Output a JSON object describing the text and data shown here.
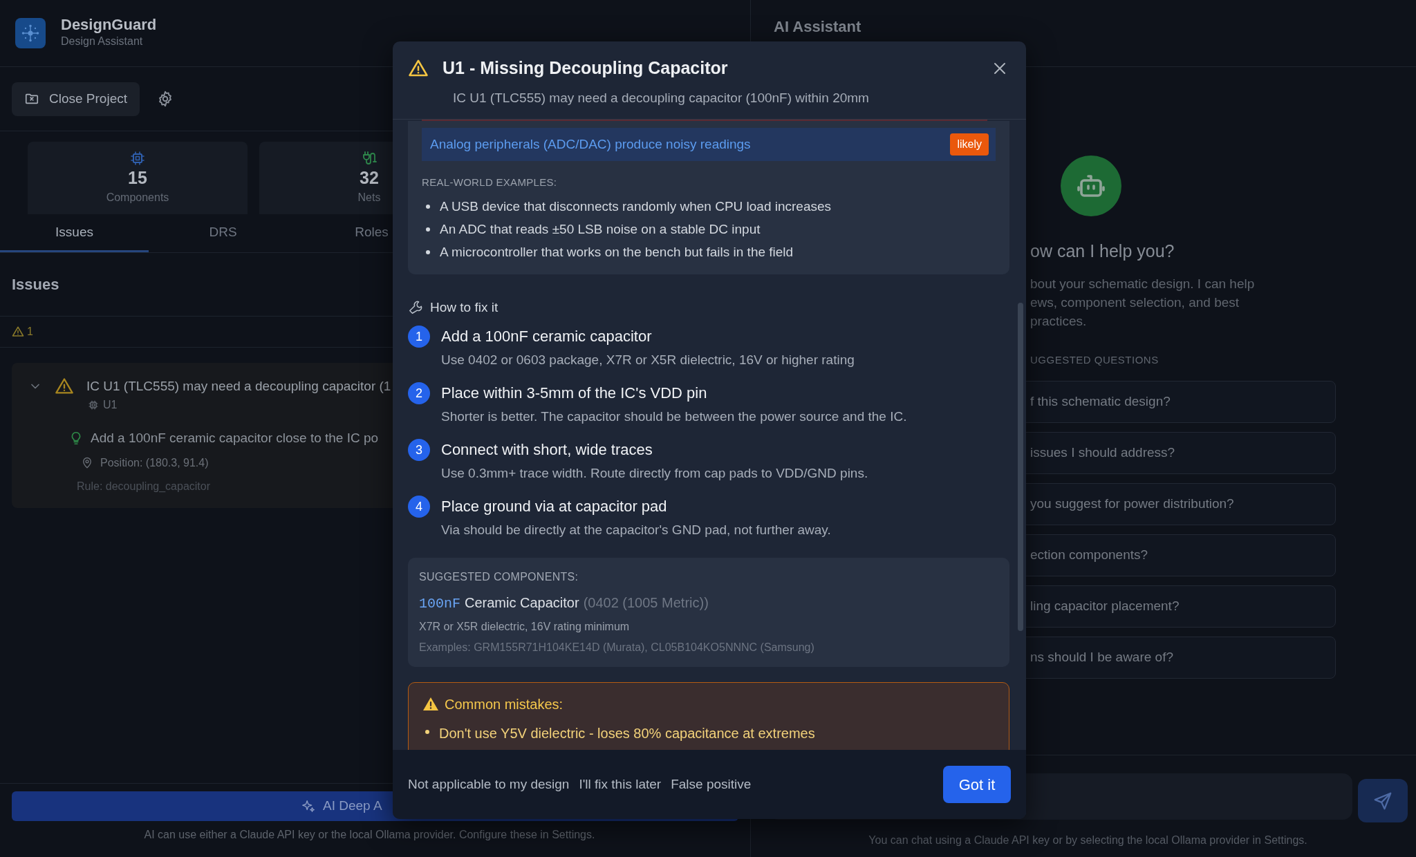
{
  "app": {
    "name": "DesignGuard",
    "subtitle": "Design Assistant"
  },
  "toolbar": {
    "close_button": "Close Project"
  },
  "stats": [
    {
      "kind": "components",
      "value": "15",
      "label": "Components"
    },
    {
      "kind": "nets",
      "value": "32",
      "label": "Nets"
    }
  ],
  "tabs": [
    {
      "label": "Issues",
      "selected": true
    },
    {
      "label": "DRS",
      "selected": false
    },
    {
      "label": "Roles",
      "selected": false
    }
  ],
  "issues_panel": {
    "heading": "Issues",
    "warning_count": "1",
    "issues": [
      {
        "title": "IC U1 (TLC555) may need a decoupling capacitor (1",
        "component": "U1",
        "expanded": true,
        "suggestion": "Add a 100nF ceramic capacitor close to the IC po",
        "position": "Position: (180.3, 91.4)",
        "rule": "Rule: decoupling_capacitor"
      }
    ]
  },
  "deep_analysis": {
    "button": "AI Deep A",
    "note": "AI can use either a Claude API key or the local Ollama provider. Configure these in Settings."
  },
  "assistant": {
    "title": "AI Assistant",
    "heading": "ow can I help you?",
    "intro": [
      "bout your schematic design. I can help",
      "ews, component selection, and best",
      "practices."
    ],
    "questions_label": "UGGESTED QUESTIONS",
    "questions": [
      "f this schematic design?",
      "issues I should address?",
      "you suggest for power distribution?",
      "ection components?",
      "ling capacitor placement?",
      "ns should I be aware of?"
    ],
    "footer": "You can chat using a Claude API key or by selecting the local Ollama provider in Settings."
  },
  "modal": {
    "title": "U1 - Missing Decoupling Capacitor",
    "subtitle": "IC U1 (TLC555) may need a decoupling capacitor (100nF) within 20mm",
    "symptom": {
      "text": "Analog peripherals (ADC/DAC) produce noisy readings",
      "likelihood": "likely"
    },
    "examples_label": "REAL-WORLD EXAMPLES:",
    "examples": [
      "A USB device that disconnects randomly when CPU load increases",
      "An ADC that reads ±50 LSB noise on a stable DC input",
      "A microcontroller that works on the bench but fails in the field"
    ],
    "fix_heading": "How to fix it",
    "steps": [
      {
        "number": "1",
        "title": "Add a 100nF ceramic capacitor",
        "detail": "Use 0402 or 0603 package, X7R or X5R dielectric, 16V or higher rating"
      },
      {
        "number": "2",
        "title": "Place within 3-5mm of the IC's VDD pin",
        "detail": "Shorter is better. The capacitor should be between the power source and the IC."
      },
      {
        "number": "3",
        "title": "Connect with short, wide traces",
        "detail": "Use 0.3mm+ trace width. Route directly from cap pads to VDD/GND pins."
      },
      {
        "number": "4",
        "title": "Place ground via at capacitor pad",
        "detail": "Via should be directly at the capacitor's GND pad, not further away."
      }
    ],
    "components_label": "SUGGESTED COMPONENTS:",
    "component": {
      "value": "100nF",
      "name": "Ceramic Capacitor",
      "package": "(0402 (1005 Metric))",
      "spec": "X7R or X5R dielectric, 16V rating minimum",
      "examples": "Examples: GRM155R71H104KE14D (Murata), CL05B104KO5NNNC (Samsung)"
    },
    "mistakes_heading": "Common mistakes:",
    "mistakes": [
      "Don't use Y5V dielectric - loses 80% capacitance at extremes"
    ],
    "actions": [
      "Not applicable to my design",
      "I'll fix this later",
      "False positive"
    ],
    "confirm_button": "Got it"
  }
}
